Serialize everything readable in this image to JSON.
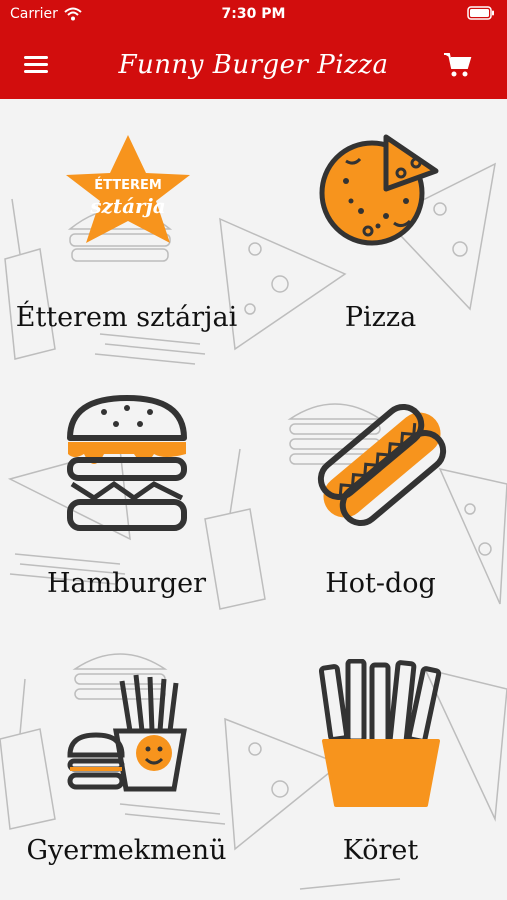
{
  "status_bar": {
    "carrier": "Carrier",
    "time": "7:30 PM"
  },
  "header": {
    "title": "Funny Burger Pizza",
    "menu_icon": "hamburger-menu-icon",
    "cart_icon": "shopping-cart-icon"
  },
  "colors": {
    "header_red": "#d20d0d",
    "accent_orange": "#f7941d",
    "icon_dark": "#333333",
    "background": "#f3f3f3"
  },
  "badge": {
    "line1": "ÉTTEREM",
    "line2": "sztárja"
  },
  "categories": [
    {
      "label": "Étterem sztárjai",
      "icon": "star-badge-burger-icon"
    },
    {
      "label": "Pizza",
      "icon": "pizza-icon"
    },
    {
      "label": "Hamburger",
      "icon": "hamburger-icon"
    },
    {
      "label": "Hot-dog",
      "icon": "hot-dog-icon"
    },
    {
      "label": "Gyermekmenü",
      "icon": "kids-menu-icon"
    },
    {
      "label": "Köret",
      "icon": "french-fries-icon"
    }
  ]
}
